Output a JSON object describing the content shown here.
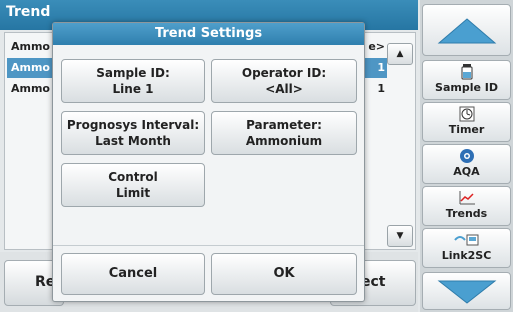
{
  "background": {
    "title": "Trend",
    "rows": [
      {
        "left": "Ammo",
        "right": "e>"
      },
      {
        "left": "Ammo",
        "right": "1"
      },
      {
        "left": "Ammo",
        "right": "1"
      }
    ],
    "bottom_left": "Re",
    "bottom_right": "ect"
  },
  "dialog": {
    "title": "Trend Settings",
    "sample_id": {
      "label": "Sample ID:",
      "value": "Line 1"
    },
    "operator_id": {
      "label": "Operator ID:",
      "value": "<All>"
    },
    "prognosys_interval": {
      "label": "Prognosys Interval:",
      "value": "Last Month"
    },
    "parameter": {
      "label": "Parameter:",
      "value": "Ammonium"
    },
    "control_limit": {
      "line1": "Control",
      "line2": "Limit"
    },
    "cancel": "Cancel",
    "ok": "OK"
  },
  "side_panel": {
    "sample_id": "Sample ID",
    "timer": "Timer",
    "aqa": "AQA",
    "trends": "Trends",
    "link2sc": "Link2SC"
  },
  "colors": {
    "title_blue": "#2f7fae",
    "accent_blue": "#4e96c4"
  }
}
